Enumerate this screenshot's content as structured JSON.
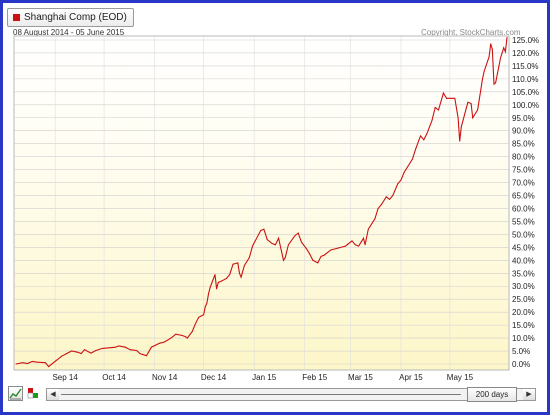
{
  "legend": {
    "label": "Shanghai Comp (EOD)",
    "color": "#cc1111"
  },
  "header": {
    "date_range": "08 August 2014 - 05 June 2015",
    "copyright": "Copyright, StockCharts.com"
  },
  "controls": {
    "period_label": "200 days",
    "left_arrow": "◀",
    "right_arrow": "▶",
    "tool_icons": [
      "line-chart-icon",
      "color-options-icon"
    ]
  },
  "chart_data": {
    "type": "line",
    "title": "",
    "xlabel": "",
    "ylabel": "",
    "ylim": [
      0,
      125
    ],
    "y_ticks": [
      "0.0%",
      "5.0%",
      "10.0%",
      "15.0%",
      "20.0%",
      "25.0%",
      "30.0%",
      "35.0%",
      "40.0%",
      "45.0%",
      "50.0%",
      "55.0%",
      "60.0%",
      "65.0%",
      "70.0%",
      "75.0%",
      "80.0%",
      "85.0%",
      "90.0%",
      "95.0%",
      "100.0%",
      "105.0%",
      "110.0%",
      "115.0%",
      "120.0%",
      "125.0%"
    ],
    "x_ticks": [
      {
        "label": "Sep 14",
        "date": "2014-09-01"
      },
      {
        "label": "Oct 14",
        "date": "2014-10-01"
      },
      {
        "label": "Nov 14",
        "date": "2014-11-01"
      },
      {
        "label": "Dec 14",
        "date": "2014-12-01"
      },
      {
        "label": "Jan 15",
        "date": "2015-01-01"
      },
      {
        "label": "Feb 15",
        "date": "2015-02-01"
      },
      {
        "label": "Mar 15",
        "date": "2015-03-01"
      },
      {
        "label": "Apr 15",
        "date": "2015-04-01"
      },
      {
        "label": "May 15",
        "date": "2015-05-01"
      }
    ],
    "grid": true,
    "series": [
      {
        "name": "Shanghai Comp (EOD)",
        "color": "#cc1111",
        "points": [
          [
            "2014-08-08",
            0
          ],
          [
            "2014-08-12",
            0.5
          ],
          [
            "2014-08-15",
            0.2
          ],
          [
            "2014-08-18",
            1.0
          ],
          [
            "2014-08-21",
            0.7
          ],
          [
            "2014-08-26",
            0.5
          ],
          [
            "2014-08-28",
            -1.0
          ],
          [
            "2014-09-02",
            1.5
          ],
          [
            "2014-09-05",
            3.0
          ],
          [
            "2014-09-08",
            4.0
          ],
          [
            "2014-09-11",
            5.0
          ],
          [
            "2014-09-15",
            4.5
          ],
          [
            "2014-09-17",
            4.0
          ],
          [
            "2014-09-19",
            5.5
          ],
          [
            "2014-09-23",
            4.2
          ],
          [
            "2014-09-26",
            5.2
          ],
          [
            "2014-09-30",
            6.0
          ],
          [
            "2014-10-08",
            6.5
          ],
          [
            "2014-10-10",
            7.0
          ],
          [
            "2014-10-14",
            6.5
          ],
          [
            "2014-10-17",
            5.5
          ],
          [
            "2014-10-21",
            5.2
          ],
          [
            "2014-10-23",
            4.0
          ],
          [
            "2014-10-27",
            3.2
          ],
          [
            "2014-10-30",
            6.5
          ],
          [
            "2014-11-04",
            8.0
          ],
          [
            "2014-11-07",
            8.5
          ],
          [
            "2014-11-11",
            10.0
          ],
          [
            "2014-11-14",
            11.5
          ],
          [
            "2014-11-18",
            11.0
          ],
          [
            "2014-11-20",
            10.5
          ],
          [
            "2014-11-21",
            10.0
          ],
          [
            "2014-11-24",
            12.5
          ],
          [
            "2014-11-26",
            15.5
          ],
          [
            "2014-11-28",
            18.0
          ],
          [
            "2014-12-01",
            19.0
          ],
          [
            "2014-12-02",
            22.0
          ],
          [
            "2014-12-03",
            23.5
          ],
          [
            "2014-12-04",
            27.0
          ],
          [
            "2014-12-05",
            29.5
          ],
          [
            "2014-12-08",
            34.5
          ],
          [
            "2014-12-09",
            29.0
          ],
          [
            "2014-12-10",
            31.5
          ],
          [
            "2014-12-12",
            32.0
          ],
          [
            "2014-12-15",
            33.0
          ],
          [
            "2014-12-17",
            34.5
          ],
          [
            "2014-12-19",
            38.5
          ],
          [
            "2014-12-22",
            39.0
          ],
          [
            "2014-12-23",
            35.0
          ],
          [
            "2014-12-24",
            33.5
          ],
          [
            "2014-12-26",
            38.0
          ],
          [
            "2014-12-29",
            41.0
          ],
          [
            "2014-12-31",
            45.5
          ],
          [
            "2015-01-05",
            51.5
          ],
          [
            "2015-01-07",
            52.0
          ],
          [
            "2015-01-09",
            48.0
          ],
          [
            "2015-01-12",
            46.5
          ],
          [
            "2015-01-14",
            46.0
          ],
          [
            "2015-01-16",
            48.5
          ],
          [
            "2015-01-19",
            40.0
          ],
          [
            "2015-01-20",
            41.0
          ],
          [
            "2015-01-22",
            46.0
          ],
          [
            "2015-01-26",
            49.5
          ],
          [
            "2015-01-28",
            50.5
          ],
          [
            "2015-01-30",
            47.0
          ],
          [
            "2015-02-02",
            44.5
          ],
          [
            "2015-02-04",
            42.5
          ],
          [
            "2015-02-06",
            40.0
          ],
          [
            "2015-02-09",
            39.0
          ],
          [
            "2015-02-11",
            41.5
          ],
          [
            "2015-02-13",
            42.0
          ],
          [
            "2015-02-17",
            44.0
          ],
          [
            "2015-02-26",
            45.5
          ],
          [
            "2015-03-02",
            47.5
          ],
          [
            "2015-03-04",
            46.0
          ],
          [
            "2015-03-06",
            45.5
          ],
          [
            "2015-03-09",
            48.5
          ],
          [
            "2015-03-10",
            46.0
          ],
          [
            "2015-03-12",
            52.0
          ],
          [
            "2015-03-16",
            56.0
          ],
          [
            "2015-03-18",
            60.0
          ],
          [
            "2015-03-20",
            61.5
          ],
          [
            "2015-03-23",
            64.5
          ],
          [
            "2015-03-25",
            63.5
          ],
          [
            "2015-03-27",
            65.0
          ],
          [
            "2015-03-30",
            69.5
          ],
          [
            "2015-04-01",
            71.0
          ],
          [
            "2015-04-03",
            74.0
          ],
          [
            "2015-04-08",
            79.0
          ],
          [
            "2015-04-10",
            83.0
          ],
          [
            "2015-04-13",
            88.0
          ],
          [
            "2015-04-15",
            86.5
          ],
          [
            "2015-04-17",
            89.0
          ],
          [
            "2015-04-20",
            94.0
          ],
          [
            "2015-04-22",
            99.0
          ],
          [
            "2015-04-24",
            98.0
          ],
          [
            "2015-04-27",
            104.5
          ],
          [
            "2015-04-29",
            102.5
          ],
          [
            "2015-05-04",
            102.5
          ],
          [
            "2015-05-06",
            95.0
          ],
          [
            "2015-05-07",
            86.0
          ],
          [
            "2015-05-08",
            91.5
          ],
          [
            "2015-05-12",
            101.0
          ],
          [
            "2015-05-14",
            100.5
          ],
          [
            "2015-05-15",
            95.0
          ],
          [
            "2015-05-18",
            98.0
          ],
          [
            "2015-05-20",
            106.0
          ],
          [
            "2015-05-21",
            110.0
          ],
          [
            "2015-05-22",
            113.0
          ],
          [
            "2015-05-25",
            118.5
          ],
          [
            "2015-05-26",
            123.5
          ],
          [
            "2015-05-27",
            121.5
          ],
          [
            "2015-05-28",
            108.0
          ],
          [
            "2015-05-29",
            108.5
          ],
          [
            "2015-06-01",
            118.0
          ],
          [
            "2015-06-03",
            122.0
          ],
          [
            "2015-06-04",
            120.5
          ],
          [
            "2015-06-05",
            126.0
          ]
        ]
      }
    ]
  }
}
